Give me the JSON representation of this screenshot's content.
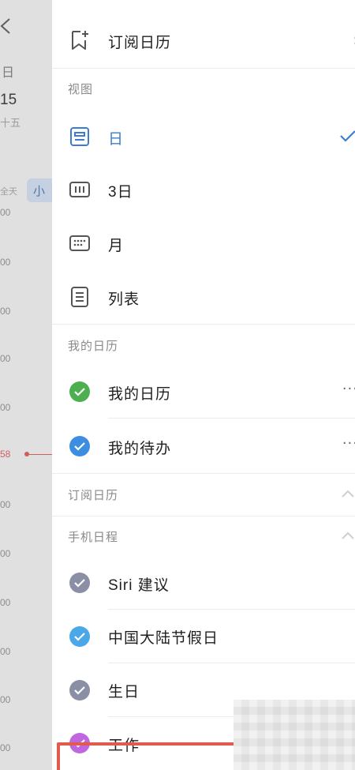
{
  "background": {
    "day_label": "日",
    "date_label": "15",
    "sub_label": "十五",
    "allday_label": "全天",
    "chip_label": "小",
    "time_labels": [
      "00",
      "00",
      "00",
      "00",
      "00",
      "00",
      "00",
      "00",
      "00",
      "00",
      "00"
    ],
    "now_label": "58"
  },
  "drawer": {
    "subscribe": {
      "label": "订阅日历",
      "icon": "bookmark-plus-icon"
    },
    "views_section": "视图",
    "views": [
      {
        "label": "日",
        "icon": "day-view-icon",
        "selected": true
      },
      {
        "label": "3日",
        "icon": "three-day-view-icon",
        "selected": false
      },
      {
        "label": "月",
        "icon": "month-view-icon",
        "selected": false
      },
      {
        "label": "列表",
        "icon": "list-view-icon",
        "selected": false
      }
    ],
    "my_calendars_section": "我的日历",
    "my_calendars": [
      {
        "label": "我的日历",
        "color": "#4caf50",
        "more": "···"
      },
      {
        "label": "我的待办",
        "color": "#3d8ee0",
        "more": "···"
      }
    ],
    "subscribed_section": "订阅日历",
    "phone_section": "手机日程",
    "phone_calendars": [
      {
        "label": "Siri 建议",
        "color": "#8a8fa6"
      },
      {
        "label": "中国大陆节假日",
        "color": "#4aa7e8"
      },
      {
        "label": "生日",
        "color": "#8a8fa6"
      },
      {
        "label": "工作",
        "color": "#c067e0"
      }
    ]
  },
  "colors": {
    "accent": "#3c7dd0",
    "highlight_frame": "#e05a4e"
  }
}
